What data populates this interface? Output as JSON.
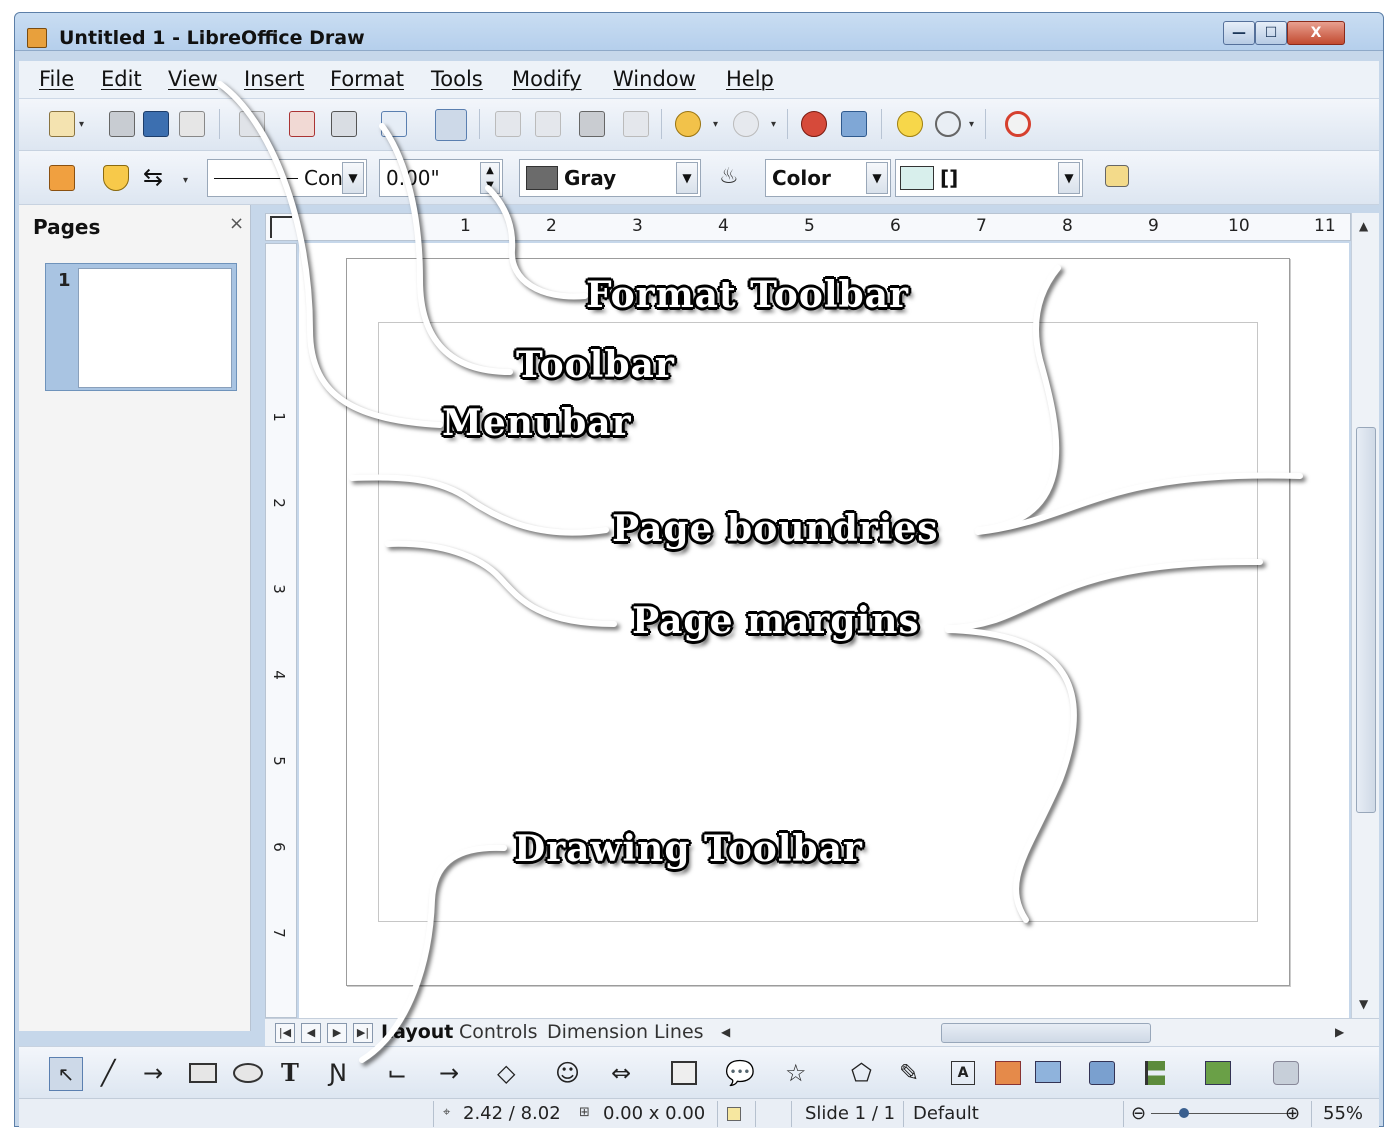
{
  "window": {
    "title": "Untitled 1 - LibreOffice Draw",
    "minimize": "—",
    "maximize": "☐",
    "close": "X"
  },
  "menubar": {
    "items": [
      {
        "label": "File"
      },
      {
        "label": "Edit"
      },
      {
        "label": "View"
      },
      {
        "label": "Insert"
      },
      {
        "label": "Format"
      },
      {
        "label": "Tools"
      },
      {
        "label": "Modify"
      },
      {
        "label": "Window"
      },
      {
        "label": "Help"
      }
    ]
  },
  "format_toolbar": {
    "line_style": "Con",
    "line_width": "0.00\"",
    "line_color": "Gray",
    "area_style": "Color",
    "area_fill": "[]",
    "line_color_hex": "#6b6b6b",
    "area_fill_hex": "#d8efec"
  },
  "pages_panel": {
    "title": "Pages",
    "close": "×",
    "pages": [
      {
        "number": "1"
      }
    ]
  },
  "ruler": {
    "h_marks": [
      "1",
      "2",
      "3",
      "4",
      "5",
      "6",
      "7",
      "8",
      "9",
      "10",
      "11"
    ],
    "v_marks": [
      "1",
      "2",
      "3",
      "4",
      "5",
      "6",
      "7"
    ]
  },
  "tabs": {
    "items": [
      "Layout",
      "Controls",
      "Dimension Lines"
    ]
  },
  "statusbar": {
    "position": "2.42 / 8.02",
    "size": "0.00 x 0.00",
    "slide": "Slide 1 / 1",
    "layout": "Default",
    "zoom": "55%"
  },
  "callouts": {
    "format_toolbar": "Format Toolbar",
    "toolbar": "Toolbar",
    "menubar": "Menubar",
    "page_boundries": "Page boundries",
    "page_margins": "Page margins",
    "drawing_toolbar": "Drawing Toolbar"
  },
  "colors": {
    "title_bar": "#b5cfec",
    "accent": "#5c7fa8",
    "close_button": "#c24a30"
  }
}
